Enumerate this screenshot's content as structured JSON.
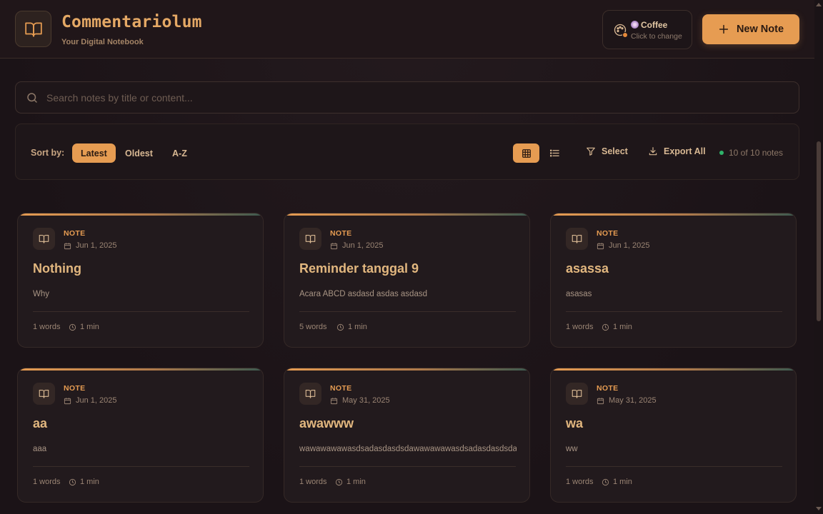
{
  "app": {
    "title": "Commentariolum",
    "subtitle": "Your Digital Notebook"
  },
  "theme": {
    "name": "Coffee",
    "hint": "Click to change"
  },
  "new_note_label": "New Note",
  "search": {
    "placeholder": "Search notes by title or content..."
  },
  "toolbar": {
    "sort_label": "Sort by:",
    "sort_options": [
      "Latest",
      "Oldest",
      "A-Z"
    ],
    "active_sort": "Latest",
    "active_view": "grid",
    "select_label": "Select",
    "export_label": "Export All",
    "count_text": "10 of 10 notes"
  },
  "colors": {
    "accent": "#e69c52",
    "background": "#1c1418",
    "status_dot": "#2fb36a"
  },
  "notes": [
    {
      "tag": "NOTE",
      "date": "Jun 1, 2025",
      "title": "Nothing",
      "body": "Why",
      "words": "1 words",
      "time": "1 min"
    },
    {
      "tag": "NOTE",
      "date": "Jun 1, 2025",
      "title": "Reminder tanggal 9",
      "body": "Acara ABCD asdasd asdas asdasd",
      "words": "5 words",
      "time": "1 min"
    },
    {
      "tag": "NOTE",
      "date": "Jun 1, 2025",
      "title": "asassa",
      "body": "asasas",
      "words": "1 words",
      "time": "1 min"
    },
    {
      "tag": "NOTE",
      "date": "Jun 1, 2025",
      "title": "aa",
      "body": "aaa",
      "words": "1 words",
      "time": "1 min"
    },
    {
      "tag": "NOTE",
      "date": "May 31, 2025",
      "title": "awawww",
      "body": "wawawawawasdsadasdasdsdawawawawasdsadasdasdsdav",
      "words": "1 words",
      "time": "1 min"
    },
    {
      "tag": "NOTE",
      "date": "May 31, 2025",
      "title": "wa",
      "body": "ww",
      "words": "1 words",
      "time": "1 min"
    }
  ]
}
